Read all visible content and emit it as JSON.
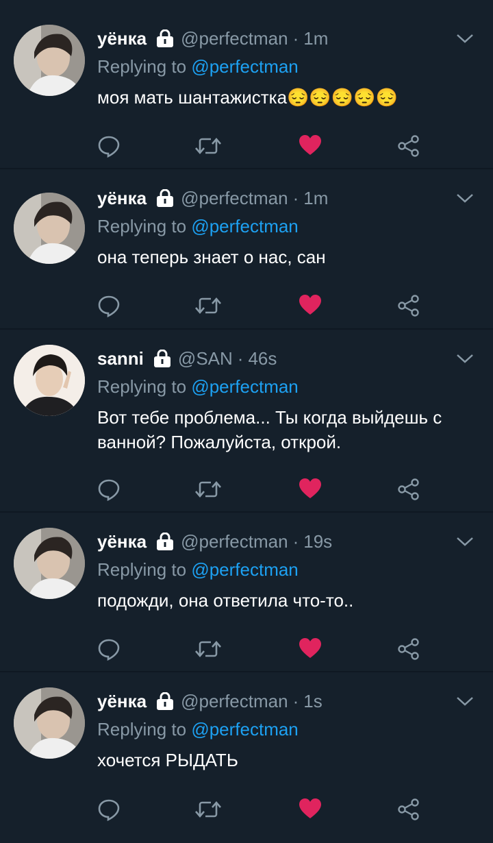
{
  "tweets": [
    {
      "name": "уёнка",
      "handle": "@perfectman",
      "time": "1m",
      "reply_prefix": "Replying to",
      "reply_to": "@perfectman",
      "text": "моя мать шантажистка😔😔😔😔😔",
      "avatar": "dim-boy"
    },
    {
      "name": "уёнка",
      "handle": "@perfectman",
      "time": "1m",
      "reply_prefix": "Replying to",
      "reply_to": "@perfectman",
      "text": "она теперь знает о нас, сан",
      "avatar": "dim-boy"
    },
    {
      "name": "sanni",
      "handle": "@SAN",
      "time": "46s",
      "reply_prefix": "Replying to",
      "reply_to": "@perfectman",
      "text": "Вот тебе проблема... Ты когда выйдешь с ванной? Пожалуйста, открой.",
      "avatar": "bright-boy"
    },
    {
      "name": "уёнка",
      "handle": "@perfectman",
      "time": "19s",
      "reply_prefix": "Replying to",
      "reply_to": "@perfectman",
      "text": "подожди, она ответила что-то..",
      "avatar": "dim-boy"
    },
    {
      "name": "уёнка",
      "handle": "@perfectman",
      "time": "1s",
      "reply_prefix": "Replying to",
      "reply_to": "@perfectman",
      "text": "хочется РЫДАТЬ",
      "avatar": "dim-boy"
    }
  ],
  "icons": {
    "reply": "comment-icon",
    "retweet": "retweet-icon",
    "like": "heart-icon",
    "share": "share-icon",
    "lock": "lock-icon",
    "menu": "chevron-down-icon"
  },
  "colors": {
    "background": "#15202b",
    "muted": "#8899a6",
    "link": "#1da1f2",
    "like": "#e0245e"
  }
}
